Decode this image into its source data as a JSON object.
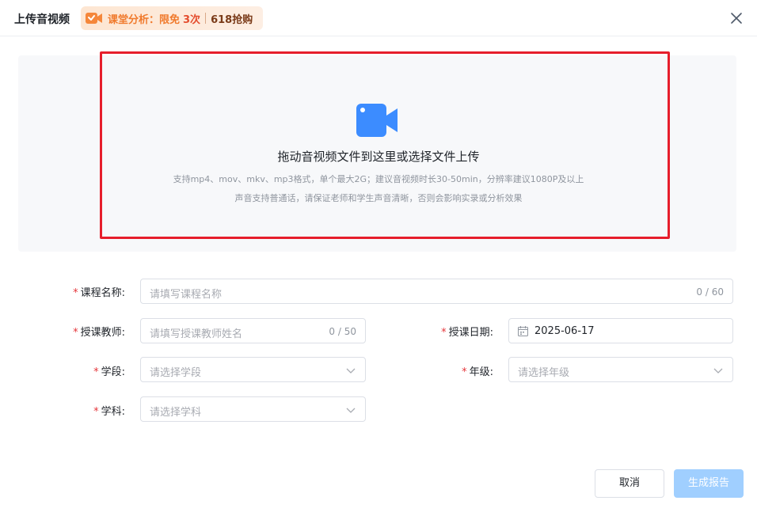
{
  "header": {
    "title": "上传音视频",
    "promo": {
      "text": "课堂分析：限免",
      "free_count": "3次",
      "sale": "618抢购"
    }
  },
  "upload": {
    "title": "拖动音视频文件到这里或选择文件上传",
    "hint_line1": "支持mp4、mov、mkv、mp3格式，单个最大2G；建议音视频时长30-50min，分辨率建议1080P及以上",
    "hint_line2": "声音支持普通话，请保证老师和学生声音清晰，否则会影响实录或分析效果"
  },
  "form": {
    "course_name": {
      "label": "课程名称:",
      "placeholder": "请填写课程名称",
      "counter": "0 / 60"
    },
    "teacher": {
      "label": "授课教师:",
      "placeholder": "请填写授课教师姓名",
      "counter": "0 / 50"
    },
    "date": {
      "label": "授课日期:",
      "value": "2025-06-17"
    },
    "stage": {
      "label": "学段:",
      "placeholder": "请选择学段"
    },
    "grade": {
      "label": "年级:",
      "placeholder": "请选择年级"
    },
    "subject": {
      "label": "学科:",
      "placeholder": "请选择学科"
    },
    "required_mark": "*"
  },
  "footer": {
    "cancel_label": "取消",
    "submit_label": "生成报告"
  },
  "colors": {
    "accent": "#3c8cff",
    "highlight_border": "#e61e2b",
    "primary_disabled": "#a0cfff",
    "required": "#e5363b"
  }
}
